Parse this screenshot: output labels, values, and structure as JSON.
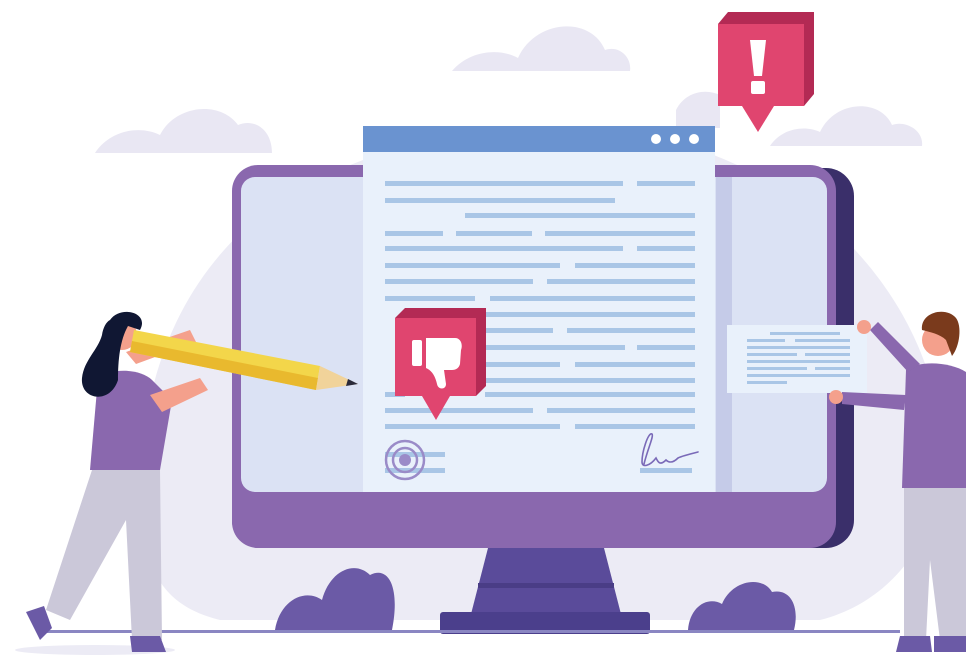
{
  "illustration": {
    "theme": "document review with negative feedback",
    "colors": {
      "background_blob": "#ecebf5",
      "cloud": "#e9e7f3",
      "monitor_frame": "#8a68ae",
      "monitor_frame_dark": "#3a2f6a",
      "monitor_screen": "#dbe2f4",
      "stand": "#5a4b9a",
      "doc_header": "#6a93d0",
      "doc_body": "#e9f1fb",
      "doc_lines": "#a9c6e6",
      "badge_pink": "#e0456f",
      "badge_pink_dark": "#b32a54",
      "pencil_yellow": "#f3d64a",
      "person_shirt": "#8a68ae",
      "person_pants": "#cbc8d9",
      "skin": "#f4a08c",
      "hair_woman": "#101733",
      "hair_man": "#7a3a1c",
      "plants": "#6b5aa6"
    },
    "icons": {
      "alert": "exclamation-icon",
      "feedback": "thumbs-down-icon",
      "window_controls": "three-dots-icon",
      "stamp": "seal-stamp-icon",
      "signature": "signature-scribble-icon"
    }
  }
}
